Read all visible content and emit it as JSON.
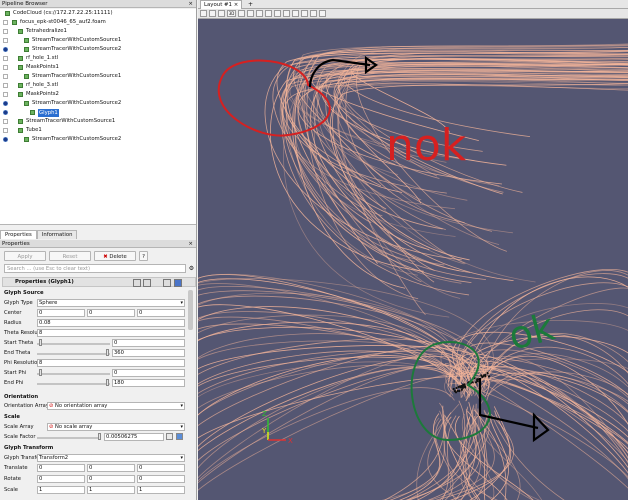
{
  "pipeline": {
    "title": "Pipeline Browser",
    "close_glyph": "×",
    "items": [
      {
        "label": "CodeCloud (cs://172.27.22.25:11111)",
        "eye": "none",
        "icon": "server-icon"
      },
      {
        "label": "focus_epk-st0046_65_auf2.foam",
        "eye": "off",
        "icon": "file-icon"
      },
      {
        "label": "Tetrahedralize1",
        "eye": "off",
        "icon": "filter-icon"
      },
      {
        "label": "StreamTracerWithCustomSource1",
        "eye": "off",
        "icon": "filter-icon"
      },
      {
        "label": "StreamTracerWithCustomSource2",
        "eye": "on",
        "icon": "filter-icon"
      },
      {
        "label": "rf_hole_1.stl",
        "eye": "off",
        "icon": "file-icon"
      },
      {
        "label": "MaskPoints1",
        "eye": "off",
        "icon": "filter-icon"
      },
      {
        "label": "StreamTracerWithCustomSource1",
        "eye": "off",
        "icon": "filter-icon"
      },
      {
        "label": "rf_hole_3.stl",
        "eye": "off",
        "icon": "file-icon"
      },
      {
        "label": "MaskPoints2",
        "eye": "off",
        "icon": "filter-icon"
      },
      {
        "label": "StreamTracerWithCustomSource2",
        "eye": "on",
        "icon": "filter-icon"
      },
      {
        "label": "Glyph1",
        "eye": "on",
        "icon": "filter-icon",
        "selected": true
      },
      {
        "label": "StreamTracerWithCustomSource1",
        "eye": "off",
        "icon": "filter-icon"
      },
      {
        "label": "Tube1",
        "eye": "off",
        "icon": "filter-icon"
      },
      {
        "label": "StreamTracerWithCustomSource2",
        "eye": "on",
        "icon": "filter-icon"
      }
    ]
  },
  "tabs": {
    "properties": "Properties",
    "information": "Information"
  },
  "properties_panel": {
    "title": "Properties",
    "apply": "Apply",
    "reset": "Reset",
    "delete": "Delete",
    "help": "?",
    "search_placeholder": "Search ... (use Esc to clear text)",
    "section_title": "Properties (Glyph1)",
    "glyph_source": {
      "heading": "Glyph Source",
      "glyph_type_label": "Glyph Type",
      "glyph_type_value": "Sphere",
      "center_label": "Center",
      "center_values": [
        "0",
        "0",
        "0"
      ],
      "radius_label": "Radius",
      "radius_value": "0.08",
      "theta_res_label": "Theta Resolution",
      "theta_res_value": "8",
      "start_theta_label": "Start Theta",
      "start_theta_value": "0",
      "end_theta_label": "End Theta",
      "end_theta_value": "360",
      "phi_res_label": "Phi Resolution",
      "phi_res_value": "8",
      "start_phi_label": "Start Phi",
      "start_phi_value": "0",
      "end_phi_label": "End Phi",
      "end_phi_value": "180"
    },
    "orientation": {
      "heading": "Orientation",
      "array_label": "Orientation Array",
      "array_value": "No orientation array"
    },
    "scale": {
      "heading": "Scale",
      "array_label": "Scale Array",
      "array_value": "No scale array",
      "factor_label": "Scale Factor",
      "factor_value": "0.00506275"
    },
    "glyph_transform": {
      "heading": "Glyph Transform",
      "transform_label": "Glyph Transform",
      "transform_value": "Transform2",
      "translate_label": "Translate",
      "translate_values": [
        "0",
        "0",
        "0"
      ],
      "rotate_label": "Rotate",
      "rotate_values": [
        "0",
        "0",
        "0"
      ],
      "scale_label": "Scale",
      "scale_values": [
        "1",
        "1",
        "1"
      ]
    }
  },
  "view": {
    "layout_tab": "Layout #1",
    "new_tab": "+",
    "toolbar_3d": "3D",
    "annotations": {
      "nok": "nok",
      "ok": "ok"
    },
    "axes": {
      "z": "Z",
      "y": "Y",
      "x": "X"
    },
    "colors": {
      "background": "#545672",
      "streamlines": "#f4b59a",
      "annotation_red": "#d62020",
      "annotation_green": "#1c7a3a",
      "annotation_black": "#000000",
      "axis_x": "#e03030",
      "axis_y": "#e0e020",
      "axis_z": "#30c030"
    }
  }
}
